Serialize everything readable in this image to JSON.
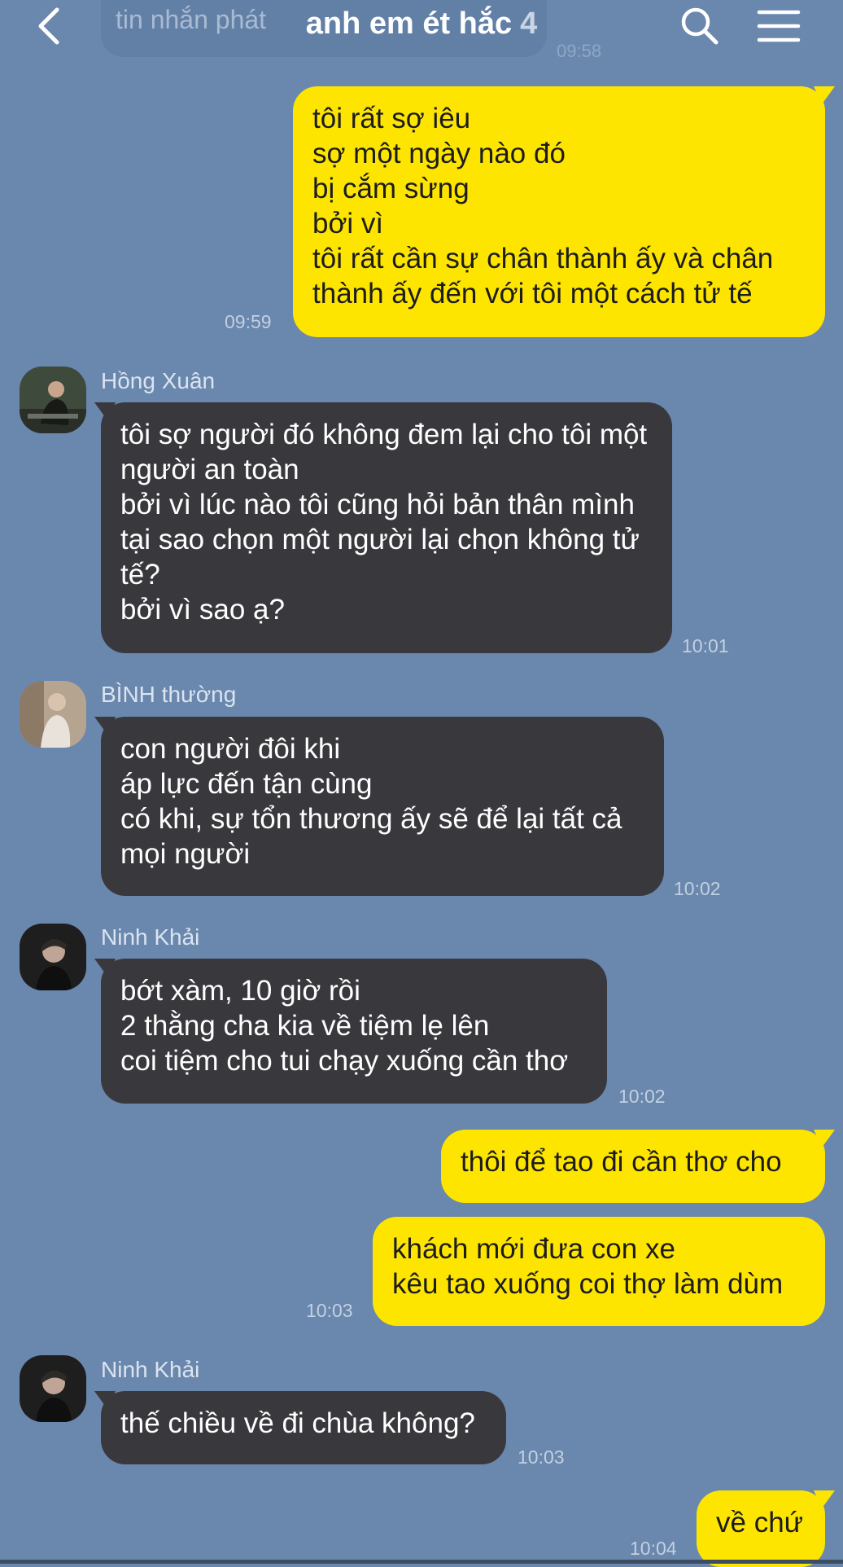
{
  "header": {
    "title": "anh em ét hắc",
    "member_count": "4",
    "prev_message_preview": "tin nhắn phát",
    "prev_message_time": "09:58"
  },
  "messages": [
    {
      "sender": "me",
      "text": "tôi rất sợ iêu\nsợ một ngày nào đó\nbị cắm sừng\nbởi vì\ntôi rất cần sự chân thành ấy và chân thành ấy đến với tôi một cách tử tế",
      "time": "09:59"
    },
    {
      "sender": "Hồng Xuân",
      "text": "tôi sợ người đó không đem lại cho tôi một người an toàn\nbởi vì lúc nào tôi cũng hỏi bản thân mình tại sao chọn một người lại chọn không tử tế?\nbởi vì sao ạ?",
      "time": "10:01"
    },
    {
      "sender": "BÌNH thường",
      "text": "con người đôi khi\náp lực đến tận cùng\ncó khi, sự tổn thương ấy sẽ để lại tất cả mọi người",
      "time": "10:02"
    },
    {
      "sender": "Ninh Khải",
      "text": "bớt xàm, 10 giờ rồi\n2 thằng cha kia về tiệm lẹ lên\ncoi tiệm cho tui chạy xuống cần thơ",
      "time": "10:02"
    },
    {
      "sender": "me",
      "text": "thôi để tao đi cần thơ cho",
      "time": ""
    },
    {
      "sender": "me",
      "text": "khách mới đưa con xe\nkêu tao xuống coi thợ làm dùm",
      "time": "10:03"
    },
    {
      "sender": "Ninh Khải",
      "text": "thế chiều về đi chùa không?",
      "time": "10:03"
    },
    {
      "sender": "me",
      "text": "về chứ",
      "time": "10:04"
    }
  ],
  "icons": {
    "back": "chevron-left-icon",
    "search": "search-icon",
    "menu": "hamburger-menu-icon"
  },
  "colors": {
    "background": "#6a87ad",
    "outgoing_bubble": "#fee500",
    "incoming_bubble": "#39393d"
  }
}
